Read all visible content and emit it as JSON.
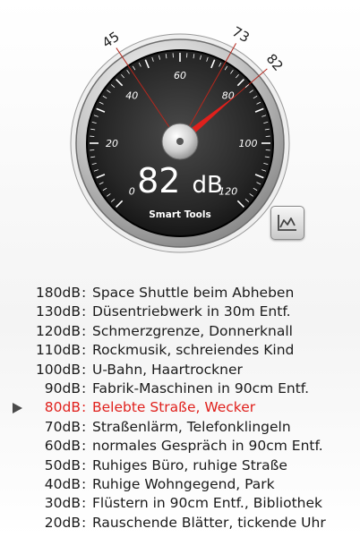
{
  "meter": {
    "value": 82,
    "unit": "dB",
    "brand": "Smart Tools",
    "scale_min": 0,
    "scale_max": 120,
    "scale_labels": [
      "0",
      "20",
      "40",
      "60",
      "80",
      "100",
      "120"
    ],
    "markers": [
      {
        "value": 45,
        "label": "45"
      },
      {
        "value": 73,
        "label": "73"
      },
      {
        "value": 82,
        "label": "82"
      }
    ],
    "colors": {
      "needle": "#e0201c",
      "current_entry": "#e0201c",
      "face": "#2a2a2a",
      "scale_text": "#ffffff"
    }
  },
  "chart_button": {
    "icon": "line-chart-icon"
  },
  "reference_list": {
    "current_index": 6,
    "separator": ":",
    "entries": [
      {
        "db": "180dB",
        "desc": "Space Shuttle beim Abheben"
      },
      {
        "db": "130dB",
        "desc": "Düsentriebwerk in 30m Entf."
      },
      {
        "db": "120dB",
        "desc": "Schmerzgrenze, Donnerknall"
      },
      {
        "db": "110dB",
        "desc": "Rockmusik, schreiendes Kind"
      },
      {
        "db": "100dB",
        "desc": "U-Bahn, Haartrockner"
      },
      {
        "db": "90dB",
        "desc": "Fabrik-Maschinen in 90cm Entf."
      },
      {
        "db": "80dB",
        "desc": "Belebte Straße, Wecker"
      },
      {
        "db": "70dB",
        "desc": "Straßenlärm, Telefonklingeln"
      },
      {
        "db": "60dB",
        "desc": "normales Gespräch in 90cm Entf."
      },
      {
        "db": "50dB",
        "desc": "Ruhiges Büro, ruhige Straße"
      },
      {
        "db": "40dB",
        "desc": "Ruhige Wohngegend, Park"
      },
      {
        "db": "30dB",
        "desc": "Flüstern in 90cm Entf., Bibliothek"
      },
      {
        "db": "20dB",
        "desc": "Rauschende Blätter, tickende Uhr"
      }
    ]
  }
}
